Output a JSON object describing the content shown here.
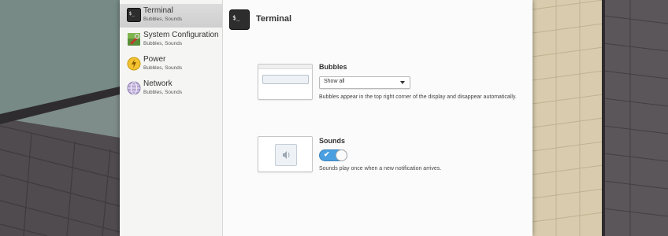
{
  "sidebar": {
    "items": [
      {
        "title": "Terminal",
        "subtitle": "Bubbles, Sounds"
      },
      {
        "title": "System Configuration",
        "subtitle": "Bubbles, Sounds"
      },
      {
        "title": "Power",
        "subtitle": "Bubbles, Sounds"
      },
      {
        "title": "Network",
        "subtitle": "Bubbles, Sounds"
      }
    ],
    "selected_index": 0
  },
  "main": {
    "title": "Terminal",
    "icon": "terminal-icon",
    "bubbles": {
      "title": "Bubbles",
      "dropdown_value": "Show all",
      "description": "Bubbles appear in the top right corner of the display and disappear automatically."
    },
    "sounds": {
      "title": "Sounds",
      "toggle_on": true,
      "description": "Sounds play once when a new notification arrives."
    }
  },
  "colors": {
    "accent": "#4a9fe0",
    "sidebar_bg": "#f5f5f4",
    "selected_bg": "#d5d5d5",
    "content_bg": "#fbfbfb"
  }
}
